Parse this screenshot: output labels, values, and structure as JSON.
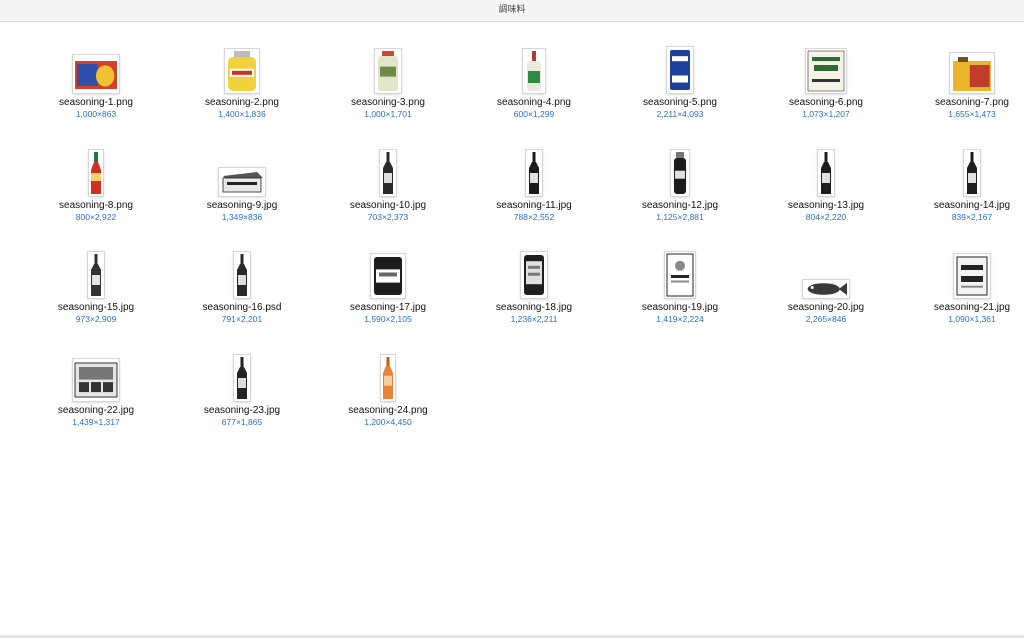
{
  "window": {
    "title": "調味料"
  },
  "files": [
    {
      "name": "seasoning-1.png",
      "dims": "1,000×863",
      "thumb": "tin-can",
      "colors": [
        "#d0402b",
        "#2f4fa8",
        "#f2c230"
      ]
    },
    {
      "name": "seasoning-2.png",
      "dims": "1,400×1,836",
      "thumb": "mustard-jar",
      "colors": [
        "#f1d23a",
        "#c8322a",
        "#ffffff"
      ]
    },
    {
      "name": "seasoning-3.png",
      "dims": "1,000×1,701",
      "thumb": "pale-jar",
      "colors": [
        "#dfe6c9",
        "#6e8a4a",
        "#c94a2c"
      ]
    },
    {
      "name": "seasoning-4.png",
      "dims": "600×1,299",
      "thumb": "green-bottle",
      "colors": [
        "#e9e9e0",
        "#2f8a44",
        "#b43c2a"
      ]
    },
    {
      "name": "seasoning-5.png",
      "dims": "2,211×4,093",
      "thumb": "blue-canister",
      "colors": [
        "#1e3f9a",
        "#ffffff",
        "#0e2562"
      ]
    },
    {
      "name": "seasoning-6.png",
      "dims": "1,073×1,207",
      "thumb": "oil-label",
      "colors": [
        "#f6f4e8",
        "#2d6a34",
        "#333333"
      ]
    },
    {
      "name": "seasoning-7.png",
      "dims": "1,655×1,473",
      "thumb": "yellow-tin",
      "colors": [
        "#e9b62b",
        "#c23c2d",
        "#7a4a1c"
      ]
    },
    {
      "name": "seasoning-8.png",
      "dims": "800×2,922",
      "thumb": "ketchup-bottle",
      "colors": [
        "#d12f24",
        "#f1d36a",
        "#1e7a3a"
      ]
    },
    {
      "name": "seasoning-9.jpg",
      "dims": "1,349×836",
      "thumb": "box",
      "colors": [
        "#e8e8e8",
        "#555555",
        "#222222"
      ]
    },
    {
      "name": "seasoning-10.jpg",
      "dims": "703×2,373",
      "thumb": "bw-bottle",
      "colors": [
        "#2a2a2a",
        "#dddddd",
        "#888888"
      ]
    },
    {
      "name": "seasoning-11.jpg",
      "dims": "788×2,552",
      "thumb": "bw-bottle",
      "colors": [
        "#1b1b1b",
        "#e0e0e0",
        "#888888"
      ]
    },
    {
      "name": "seasoning-12.jpg",
      "dims": "1,125×2,881",
      "thumb": "bw-shaker",
      "colors": [
        "#1d1d1d",
        "#e0e0e0",
        "#777777"
      ]
    },
    {
      "name": "seasoning-13.jpg",
      "dims": "804×2,220",
      "thumb": "bw-bottle",
      "colors": [
        "#1e1e1e",
        "#e0e0e0",
        "#777777"
      ]
    },
    {
      "name": "seasoning-14.jpg",
      "dims": "839×2,167",
      "thumb": "bw-bottle",
      "colors": [
        "#1e1e1e",
        "#e0e0e0",
        "#777777"
      ]
    },
    {
      "name": "seasoning-15.jpg",
      "dims": "973×2,909",
      "thumb": "bw-tall-bottle",
      "colors": [
        "#333333",
        "#e6e6e6",
        "#999999"
      ]
    },
    {
      "name": "seasoning-16.psd",
      "dims": "791×2,201",
      "thumb": "bw-bottle",
      "colors": [
        "#2a2a2a",
        "#dddddd",
        "#888888"
      ]
    },
    {
      "name": "seasoning-17.jpg",
      "dims": "1,590×2,105",
      "thumb": "bw-salt-can",
      "colors": [
        "#1c1c1c",
        "#ffffff",
        "#666666"
      ]
    },
    {
      "name": "seasoning-18.jpg",
      "dims": "1,236×2,211",
      "thumb": "bw-can",
      "colors": [
        "#1f1f1f",
        "#e0e0e0",
        "#777777"
      ]
    },
    {
      "name": "seasoning-19.jpg",
      "dims": "1,419×2,224",
      "thumb": "bw-package",
      "colors": [
        "#ffffff",
        "#222222",
        "#888888"
      ]
    },
    {
      "name": "seasoning-20.jpg",
      "dims": "2,265×846",
      "thumb": "fish",
      "colors": [
        "#3a3a3a",
        "#bbbbbb",
        "#ffffff"
      ]
    },
    {
      "name": "seasoning-21.jpg",
      "dims": "1,090×1,361",
      "thumb": "mustard-box",
      "colors": [
        "#f4f4f4",
        "#222222",
        "#888888"
      ]
    },
    {
      "name": "seasoning-22.jpg",
      "dims": "1,439×1,317",
      "thumb": "tray",
      "colors": [
        "#e6e6e6",
        "#333333",
        "#777777"
      ]
    },
    {
      "name": "seasoning-23.jpg",
      "dims": "677×1,865",
      "thumb": "bw-bottle",
      "colors": [
        "#242424",
        "#dddddd",
        "#888888"
      ]
    },
    {
      "name": "seasoning-24.png",
      "dims": "1,200×4,450",
      "thumb": "orange-bottle",
      "colors": [
        "#e8843a",
        "#f4d0a0",
        "#c25a1e"
      ]
    }
  ]
}
